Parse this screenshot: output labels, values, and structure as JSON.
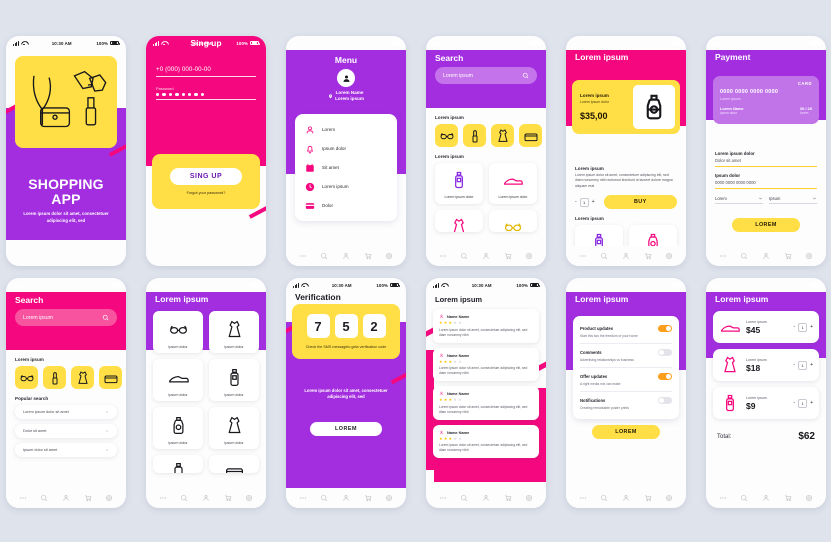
{
  "statusbar": {
    "time": "10:30 AM",
    "battery": "100%"
  },
  "nav": {
    "items": [
      "more-icon",
      "search-icon",
      "person-icon",
      "cart-icon",
      "gear-icon"
    ]
  },
  "colors": {
    "background": "#dfe3ec",
    "purple": "#a32ee0",
    "pink": "#f5087f",
    "yellow": "#ffdf45",
    "orange": "#ff9d1c",
    "card": "#ffffff"
  },
  "screens": {
    "splash": {
      "title": "SHOPPING APP",
      "subtitle": "Lorem ipsum dolor sit amet, consectetuer adipiscing elit, sed"
    },
    "signup": {
      "title": "Sing up",
      "phone_value": "+0 (000) 000-00-00",
      "password_label": "Password",
      "password_dots": 8,
      "button": "SING UP",
      "forgot": "Forgot your password?"
    },
    "menu": {
      "title": "Menu",
      "user_name": "Lorem Name",
      "user_location": "Lorem ipsum",
      "items": [
        {
          "label": "Lorem",
          "icon": "user-icon"
        },
        {
          "label": "Ipsum dolor",
          "icon": "bell-icon"
        },
        {
          "label": "Sit amet",
          "icon": "calendar-icon"
        },
        {
          "label": "Lorem ipsum",
          "icon": "clock-icon"
        },
        {
          "label": "Dolor",
          "icon": "card-icon"
        }
      ]
    },
    "search_purple": {
      "title": "Search",
      "search_placeholder": "Lorem ipsum",
      "categories_label": "Lorem ipsum",
      "products_label": "Lorem ipsum",
      "chips": [
        "glasses-icon",
        "lipstick-icon",
        "dress-icon",
        "bag-icon"
      ],
      "products": [
        {
          "caption": "Lorem ipsum dolor",
          "icon": "cream-icon"
        },
        {
          "caption": "Lorem ipsum dolor",
          "icon": "shoe-icon"
        },
        {
          "caption": "",
          "icon": "dress-icon"
        },
        {
          "caption": "",
          "icon": "glasses-icon"
        }
      ]
    },
    "product": {
      "title": "Lorem ipsum",
      "card_title": "Lorem ipsum",
      "card_desc": "Lorem ipsum dolor",
      "price": "$35,00",
      "section_label": "Lorem ipsum",
      "description": "Lorem ipsum dolor sit amet, consectetuer adipiscing elit, sed diam nonummy nibh euismod tincidunt ut laoreet dolore magna aliquam erat",
      "qty": "1",
      "minus": "-",
      "plus": "+",
      "buy_label": "BUY",
      "related_label": "Lorem ipsum",
      "related": [
        {
          "caption": "Lorem ipsum",
          "icon": "cream-icon"
        },
        {
          "caption": "Lorem ipsum",
          "icon": "perfume-icon"
        }
      ]
    },
    "payment": {
      "title": "Payment",
      "card_brand": "CARD",
      "card_number": "0000 0000 0000 0000",
      "card_sub": "Lorem ipsum",
      "card_holder_label": "Lorem Name",
      "card_holder_sub": "ipsum dolor",
      "card_expiry": "06 / 20",
      "card_expiry_sub": "lorem",
      "field1_label": "Lorem ipsum dolor",
      "field1_value": "Dolor sit amet",
      "field2_label": "Ipsum dolor",
      "field2_value": "0000 0000 0000 0000",
      "select1": "Lorem",
      "select2": "Ipsum",
      "button": "LOREM"
    },
    "search_pink": {
      "title": "Search",
      "search_placeholder": "Lorem ipsum",
      "categories_label": "Lorem ipsum",
      "popular_label": "Popular search",
      "chips": [
        "glasses-icon",
        "lipstick-icon",
        "dress-icon",
        "bag-icon"
      ],
      "popular": [
        "Lorem ipsum dolor sit amet",
        "Dolor sit amet",
        "Ipsum dolor sit amet"
      ]
    },
    "catalog": {
      "title": "Lorem ipsum",
      "items": [
        {
          "caption": "Ipsum dolor",
          "icon": "glasses-icon"
        },
        {
          "caption": "Ipsum dolor",
          "icon": "dress-icon"
        },
        {
          "caption": "Ipsum dolor",
          "icon": "shoe-icon"
        },
        {
          "caption": "Ipsum dolor",
          "icon": "cream-icon"
        },
        {
          "caption": "Ipsum dolor",
          "icon": "perfume-icon"
        },
        {
          "caption": "Ipsum dolor",
          "icon": "dress-icon"
        },
        {
          "caption": "",
          "icon": "cream-icon"
        },
        {
          "caption": "",
          "icon": "bag-icon"
        }
      ]
    },
    "verification": {
      "title": "Verification",
      "code": [
        "7",
        "5",
        "2"
      ],
      "hint": "Check the SMS messageto geta verification code",
      "message": "Lorem ipsum dolor sit amet, consectetuer adipiscing elit, sed",
      "button": "LOREM"
    },
    "reviews": {
      "title": "Lorem ipsum",
      "items": [
        {
          "name": "Name Name",
          "rating": 3,
          "text": "Lorem ipsum dolor sit amet, consectetuer adipiscing elit, sed diam nonummy nibh"
        },
        {
          "name": "Name Name",
          "rating": 3,
          "text": "Lorem ipsum dolor sit amet, consectetuer adipiscing elit, sed diam nonummy nibh"
        },
        {
          "name": "Name Name",
          "rating": 3,
          "text": "Lorem ipsum dolor sit amet, consectetuer adipiscing elit, sed diam nonummy nibh"
        },
        {
          "name": "Name Name",
          "rating": 3,
          "text": "Lorem ipsum dolor sit amet, consectetuer adipiscing elit, sed diam nonummy nibh"
        }
      ]
    },
    "settings": {
      "title": "Lorem ipsum",
      "rows": [
        {
          "name": "Product updates",
          "desc": "Start this two the freedom of your home",
          "on": true
        },
        {
          "name": "Comments",
          "desc": "Advertising relationships vs business",
          "on": false
        },
        {
          "name": "Offer updates",
          "desc": "A right media mix can make",
          "on": true
        },
        {
          "name": "Notifications",
          "desc": "Creating remarkable poster prints",
          "on": false
        }
      ],
      "button": "LOREM"
    },
    "cart": {
      "title": "Lorem ipsum",
      "items": [
        {
          "name": "Lorem ipsum",
          "price": "$45",
          "qty": "1",
          "icon": "shoe-icon"
        },
        {
          "name": "Lorem ipsum",
          "price": "$18",
          "qty": "1",
          "icon": "dress-icon"
        },
        {
          "name": "Lorem ipsum",
          "price": "$9",
          "qty": "1",
          "icon": "cream-icon"
        }
      ],
      "total_label": "Total:",
      "total_value": "$62",
      "minus": "-",
      "plus": "+"
    }
  }
}
